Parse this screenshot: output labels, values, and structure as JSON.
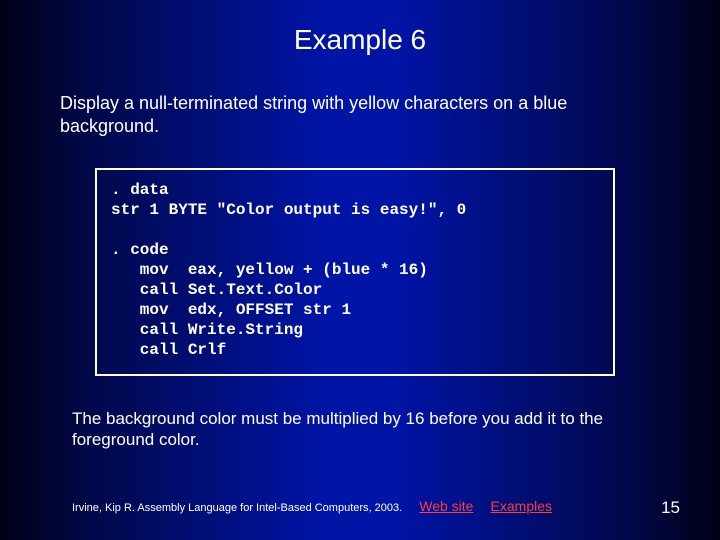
{
  "title": "Example 6",
  "description": "Display a null-terminated string with yellow characters on a blue background.",
  "code": ". data\nstr 1 BYTE \"Color output is easy!\", 0\n\n. code\n   mov  eax, yellow + (blue * 16)\n   call Set.Text.Color\n   mov  edx, OFFSET str 1\n   call Write.String\n   call Crlf",
  "note": "The background color must be multiplied by 16 before you add it to the foreground color.",
  "footer": {
    "citation": "Irvine, Kip R. Assembly Language for Intel-Based Computers, 2003.",
    "link_web": "Web site",
    "link_examples": "Examples"
  },
  "page_number": "15"
}
